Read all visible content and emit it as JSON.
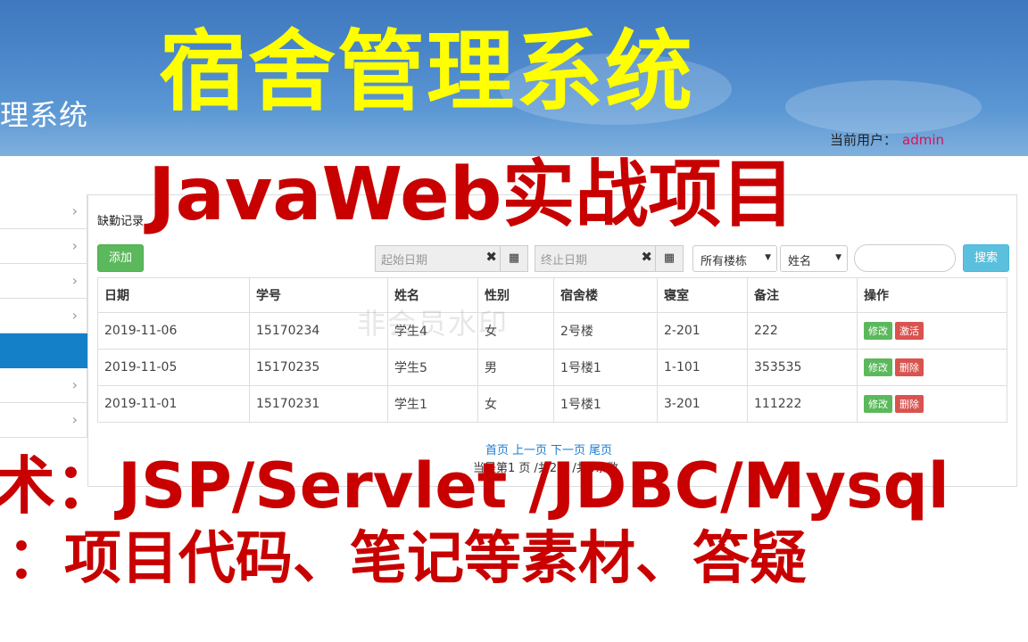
{
  "header": {
    "system_title": "理系统",
    "user_label": "当前用户：",
    "username": "admin"
  },
  "sidebar": {
    "items": [
      {
        "icon": "chevron-right-icon",
        "active": false
      },
      {
        "icon": "chevron-right-icon",
        "active": false
      },
      {
        "icon": "chevron-right-icon",
        "active": false
      },
      {
        "icon": "chevron-right-icon",
        "active": false
      },
      {
        "icon": "",
        "active": true
      },
      {
        "icon": "chevron-right-icon",
        "active": false
      },
      {
        "icon": "chevron-right-icon",
        "active": false
      }
    ]
  },
  "panel": {
    "title": "缺勤记录",
    "add_label": "添加",
    "start_date_placeholder": "起始日期",
    "end_date_placeholder": "终止日期",
    "building_select": "所有楼栋",
    "field_select": "姓名",
    "search_value": "",
    "search_label": "搜索",
    "watermark": "非会员水印"
  },
  "table": {
    "columns": [
      "日期",
      "学号",
      "姓名",
      "性别",
      "宿舍楼",
      "寝室",
      "备注",
      "操作"
    ],
    "rows": [
      {
        "date": "2019-11-06",
        "sid": "15170234",
        "name": "学生4",
        "gender": "女",
        "building": "2号楼",
        "room": "2-201",
        "note": "222",
        "edit": "修改",
        "action": "激活"
      },
      {
        "date": "2019-11-05",
        "sid": "15170235",
        "name": "学生5",
        "gender": "男",
        "building": "1号楼1",
        "room": "1-101",
        "note": "353535",
        "edit": "修改",
        "action": "删除"
      },
      {
        "date": "2019-11-01",
        "sid": "15170231",
        "name": "学生1",
        "gender": "女",
        "building": "1号楼1",
        "room": "3-201",
        "note": "111222",
        "edit": "修改",
        "action": "删除"
      }
    ]
  },
  "pagination": {
    "first": "首页",
    "prev": "上一页",
    "next": "下一页",
    "last": "尾页",
    "info": "当是第1 页 /共2页 /共4条数"
  },
  "overlay": {
    "line1": "宿舍管理系统",
    "line2": "JavaWeb实战项目",
    "line3": "术：JSP/Servlet /JDBC/Mysql",
    "line4": "：项目代码、笔记等素材、答疑"
  },
  "colors": {
    "header_blue": "#4a86c9",
    "overlay_yellow": "#ffff00",
    "overlay_red": "#c80000",
    "active_blue": "#1380c8"
  }
}
